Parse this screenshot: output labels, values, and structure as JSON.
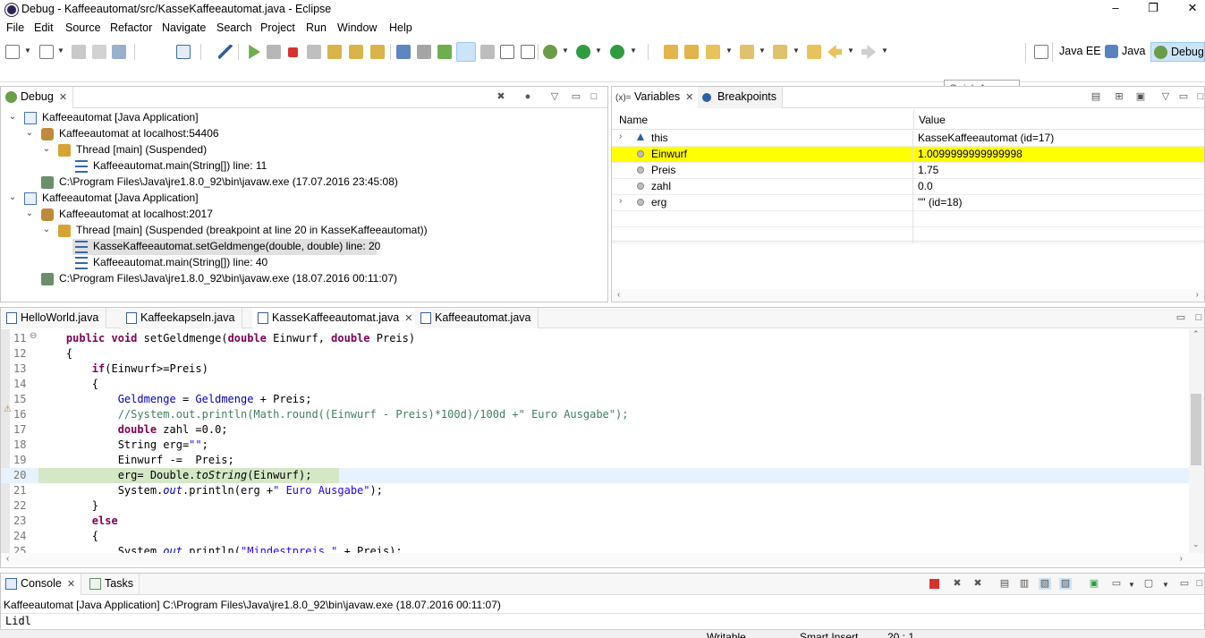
{
  "window": {
    "title": "Debug - Kaffeeautomat/src/KasseKaffeeautomat.java - Eclipse",
    "minimize": "–",
    "maximize": "❐",
    "close": "✕"
  },
  "menu": [
    "File",
    "Edit",
    "Source",
    "Refactor",
    "Navigate",
    "Search",
    "Project",
    "Run",
    "Window",
    "Help"
  ],
  "toolbar": {
    "quick_access_placeholder": "Quick Access",
    "perspectives": [
      "Java EE",
      "Java",
      "Debug"
    ]
  },
  "debug_view": {
    "tab": "Debug",
    "tree": [
      {
        "label": "Kaffeeautomat [Java Application]"
      },
      {
        "label": "Kaffeeautomat at localhost:54406"
      },
      {
        "label": "Thread [main] (Suspended)"
      },
      {
        "label": "Kaffeeautomat.main(String[]) line: 11"
      },
      {
        "label": "C:\\Program Files\\Java\\jre1.8.0_92\\bin\\javaw.exe (17.07.2016 23:45:08)"
      },
      {
        "label": "Kaffeeautomat [Java Application]"
      },
      {
        "label": "Kaffeeautomat at localhost:2017"
      },
      {
        "label": "Thread [main] (Suspended (breakpoint at line 20 in KasseKaffeeautomat))"
      },
      {
        "label": "KasseKaffeeautomat.setGeldmenge(double, double) line: 20"
      },
      {
        "label": "Kaffeeautomat.main(String[]) line: 40"
      },
      {
        "label": "C:\\Program Files\\Java\\jre1.8.0_92\\bin\\javaw.exe (18.07.2016 00:11:07)"
      }
    ]
  },
  "variables_view": {
    "tabs": [
      "Variables",
      "Breakpoints"
    ],
    "tab_prefix": "(x)=",
    "columns": [
      "Name",
      "Value"
    ],
    "rows": [
      {
        "name": "this",
        "value": "KasseKaffeeautomat  (id=17)"
      },
      {
        "name": "Einwurf",
        "value": "1.0099999999999998"
      },
      {
        "name": "Preis",
        "value": "1.75"
      },
      {
        "name": "zahl",
        "value": "0.0"
      },
      {
        "name": "erg",
        "value": "\"\" (id=18)"
      }
    ]
  },
  "editor": {
    "tabs": [
      "HelloWorld.java",
      "Kaffeekapseln.java",
      "KasseKaffeeautomat.java",
      "Kaffeeautomat.java"
    ],
    "line_numbers": [
      "11",
      "12",
      "13",
      "14",
      "15",
      "16",
      "17",
      "18",
      "19",
      "20",
      "21",
      "22",
      "23",
      "24",
      "25"
    ],
    "lines": {
      "l11a": "    ",
      "l11kw1": "public",
      "l11sp1": " ",
      "l11kw2": "void",
      "l11b": " setGeldmenge(",
      "l11kw3": "double",
      "l11c": " Einwurf, ",
      "l11kw4": "double",
      "l11d": " Preis)",
      "l12": "    {",
      "l13a": "        ",
      "l13kw": "if",
      "l13b": "(Einwurf>=Preis)",
      "l14": "        {",
      "l15a": "            ",
      "l15f1": "Geldmenge",
      "l15b": " = ",
      "l15f2": "Geldmenge",
      "l15c": " + Preis;",
      "l16a": "            ",
      "l16cm": "//System.out.println(Math.round((Einwurf - Preis)*100d)/100d +\" Euro Ausgabe\");",
      "l17a": "            ",
      "l17kw": "double",
      "l17b": " zahl =0.0;",
      "l18a": "            String erg=",
      "l18st": "\"\"",
      "l18b": ";",
      "l19": "            Einwurf -=  Preis;",
      "l20a": "            erg= Double.",
      "l20it": "toString",
      "l20b": "(Einwurf);",
      "l21a": "            System.",
      "l21f": "out",
      "l21b": ".println(erg +",
      "l21st": "\" Euro Ausgabe\"",
      "l21c": ");",
      "l22": "        }",
      "l23a": "        ",
      "l23kw": "else",
      "l24": "        {",
      "l25a": "            System.",
      "l25f": "out",
      "l25b": ".println(",
      "l25st": "\"Mindestpreis \"",
      "l25c": " + Preis);"
    }
  },
  "console_view": {
    "tabs": [
      "Console",
      "Tasks"
    ],
    "header": "Kaffeeautomat [Java Application] C:\\Program Files\\Java\\jre1.8.0_92\\bin\\javaw.exe (18.07.2016 00:11:07)",
    "output": "Lidl"
  },
  "status": {
    "writable": "Writable",
    "insert": "Smart Insert",
    "position": "20 : 1"
  },
  "colors": {
    "highlight_var": "#ffff00",
    "current_line": "#d4e8c6",
    "active_perspective": "#cce4f7"
  }
}
